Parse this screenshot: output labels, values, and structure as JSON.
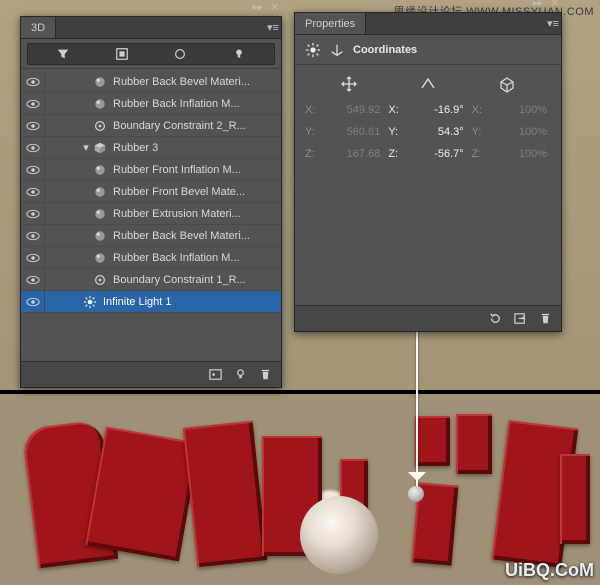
{
  "watermark": {
    "top": "思缘设计论坛  WWW.MISSYUAN.COM",
    "bottom": "UiBQ.CoM"
  },
  "panel3d": {
    "title": "3D",
    "filter_icons": [
      "filters-icon",
      "trash-icon",
      "render-icon",
      "light-bulb-icon"
    ],
    "layers": [
      {
        "vis": true,
        "indent": 1,
        "type": "material",
        "label": "Rubber Back Bevel Materi..."
      },
      {
        "vis": true,
        "indent": 1,
        "type": "material",
        "label": "Rubber Back Inflation M..."
      },
      {
        "vis": true,
        "indent": 1,
        "type": "constraint",
        "label": "Boundary Constraint 2_R..."
      },
      {
        "vis": true,
        "indent": 0,
        "type": "mesh",
        "collapse": true,
        "label": "Rubber 3"
      },
      {
        "vis": true,
        "indent": 1,
        "type": "material",
        "label": "Rubber Front Inflation M..."
      },
      {
        "vis": true,
        "indent": 1,
        "type": "material",
        "label": "Rubber Front Bevel Mate..."
      },
      {
        "vis": true,
        "indent": 1,
        "type": "material",
        "label": "Rubber Extrusion Materi..."
      },
      {
        "vis": true,
        "indent": 1,
        "type": "material",
        "label": "Rubber Back Bevel Materi..."
      },
      {
        "vis": true,
        "indent": 1,
        "type": "material",
        "label": "Rubber Back Inflation M..."
      },
      {
        "vis": true,
        "indent": 1,
        "type": "constraint",
        "label": "Boundary Constraint 1_R..."
      },
      {
        "vis": true,
        "indent": 0,
        "type": "light",
        "selected": true,
        "label": "Infinite Light 1"
      }
    ]
  },
  "props": {
    "title": "Properties",
    "section_label": "Coordinates",
    "column_icons": [
      "move-icon",
      "rotate-icon",
      "scale-icon"
    ],
    "rows": [
      {
        "axis": "X",
        "pos": "549.92",
        "rot": "-16.9°",
        "scale": "100%"
      },
      {
        "axis": "Y",
        "pos": "560.81",
        "rot": "54.3°",
        "scale": "100%"
      },
      {
        "axis": "Z",
        "pos": "167.68",
        "rot": "-56.7°",
        "scale": "100%"
      }
    ]
  }
}
